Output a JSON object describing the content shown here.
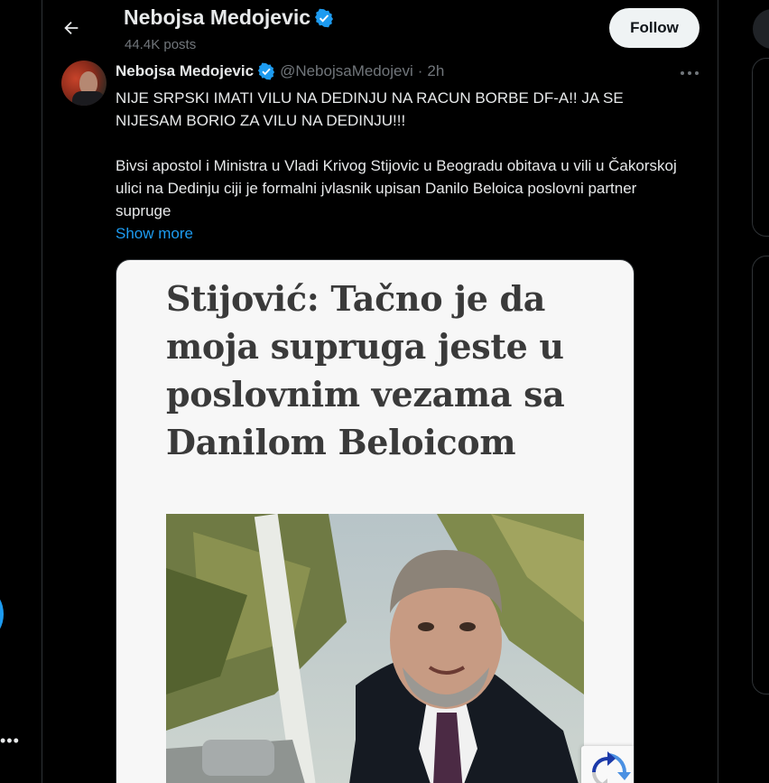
{
  "header": {
    "title": "Nebojsa Medojevic",
    "posts_count": "44.4K posts",
    "follow_label": "Follow"
  },
  "tweet": {
    "author_name": "Nebojsa Medojevic",
    "author_handle": "@NebojsaMedojevi",
    "separator": "·",
    "timestamp": "2h",
    "text_line_1": "NIJE SRPSKI IMATI VILU NA DEDINJU NA RACUN BORBE DF-A!! JA SE NIJESAM BORIO ZA VILU NA DEDINJU!!!",
    "text_line_2": "Bivsi apostol i Ministra u Vladi Krivog Stijovic u Beogradu obitava u vili  u Čakorskoj ulici na Dedinju ciji je formalni jvlasnik upisan Danilo Beloica poslovni partner supruge",
    "show_more_label": "Show more"
  },
  "media": {
    "headline": "Stijović: Tačno je da moja supruga jeste u poslovnim vezama sa Danilom Beloicom"
  },
  "colors": {
    "background": "#000000",
    "text": "#e7e9ea",
    "muted": "#71767b",
    "accent": "#1d9bf0",
    "border": "#2f3336",
    "follow_button_bg": "#eff3f4"
  },
  "icons": {
    "back": "arrow-left-icon",
    "verified": "verified-badge-icon",
    "more": "ellipsis-icon"
  }
}
